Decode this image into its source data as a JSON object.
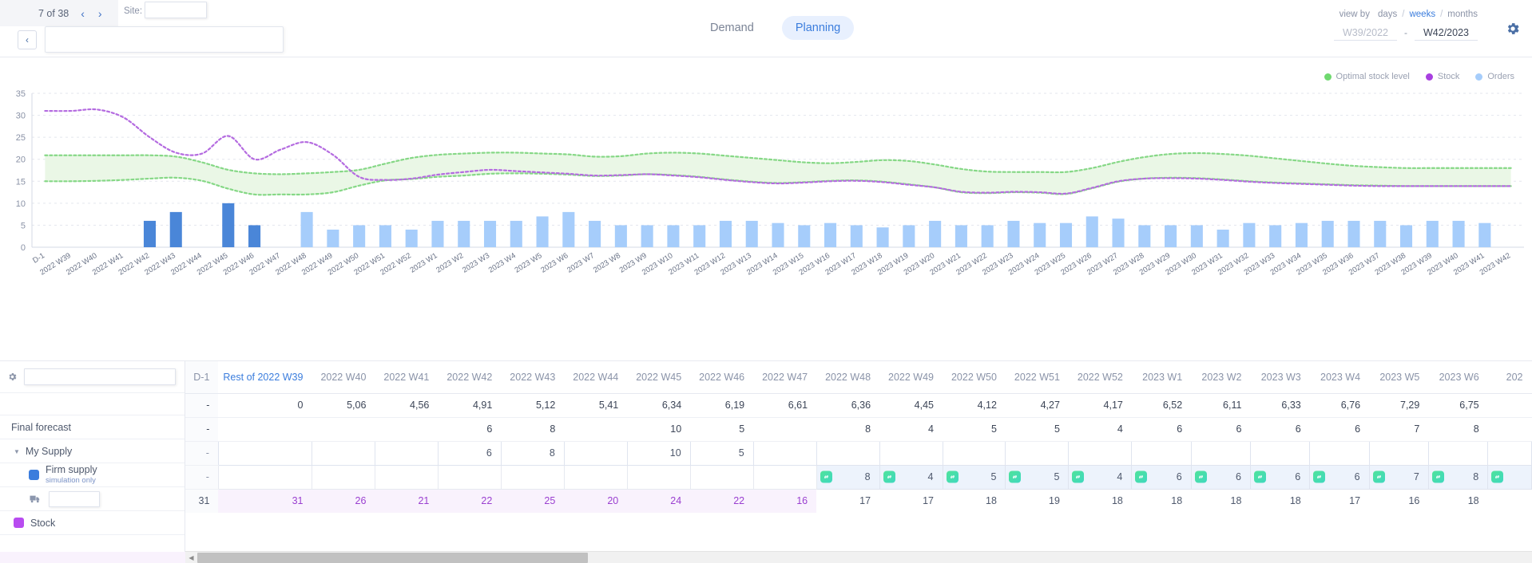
{
  "topbar": {
    "pager_text": "7 of 38",
    "prev_label": "‹",
    "next_label": "›",
    "site_label": "Site:",
    "site_value": "",
    "back_label": "‹",
    "name_value": "",
    "tabs": [
      {
        "label": "Demand",
        "active": false
      },
      {
        "label": "Planning",
        "active": true
      }
    ],
    "view_by_label": "view by",
    "view_options": [
      {
        "label": "days",
        "active": false
      },
      {
        "label": "weeks",
        "active": true
      },
      {
        "label": "months",
        "active": false
      }
    ],
    "separator": "/",
    "range_from": "W39/2022",
    "range_dash": "-",
    "range_to": "W42/2023",
    "gear_icon": "gear-icon"
  },
  "legend": [
    {
      "label": "Optimal stock level",
      "color": "#6fd96f"
    },
    {
      "label": "Stock",
      "color": "#a83fe0"
    },
    {
      "label": "Orders",
      "color": "#a6cdfb"
    }
  ],
  "chart_data": {
    "type": "bar",
    "title": "",
    "xlabel": "",
    "ylabel": "",
    "ylim": [
      0,
      35
    ],
    "yticks": [
      0,
      5,
      10,
      15,
      20,
      25,
      30,
      35
    ],
    "grid": true,
    "legend_position": "top-right",
    "categories": [
      "D-1",
      "2022 W39",
      "2022 W40",
      "2022 W41",
      "2022 W42",
      "2022 W43",
      "2022 W44",
      "2022 W45",
      "2022 W46",
      "2022 W47",
      "2022 W48",
      "2022 W49",
      "2022 W50",
      "2022 W51",
      "2022 W52",
      "2023 W1",
      "2023 W2",
      "2023 W3",
      "2023 W4",
      "2023 W5",
      "2023 W6",
      "2023 W7",
      "2023 W8",
      "2023 W9",
      "2023 W10",
      "2023 W11",
      "2023 W12",
      "2023 W13",
      "2023 W14",
      "2023 W15",
      "2023 W16",
      "2023 W17",
      "2023 W18",
      "2023 W19",
      "2023 W20",
      "2023 W21",
      "2023 W22",
      "2023 W23",
      "2023 W24",
      "2023 W25",
      "2023 W26",
      "2023 W27",
      "2023 W28",
      "2023 W29",
      "2023 W30",
      "2023 W31",
      "2023 W32",
      "2023 W33",
      "2023 W34",
      "2023 W35",
      "2023 W36",
      "2023 W37",
      "2023 W38",
      "2023 W39",
      "2023 W40",
      "2023 W41",
      "2023 W42"
    ],
    "series": [
      {
        "name": "Orders",
        "type": "bar",
        "color": "#a6cdfb",
        "values": [
          0,
          0,
          0,
          0,
          6,
          8,
          0,
          10,
          5,
          0,
          8,
          4,
          5,
          5,
          4,
          6,
          6,
          6,
          6,
          7,
          8,
          6,
          5,
          5,
          5,
          5,
          6,
          6,
          5.5,
          5,
          5.5,
          5,
          4.5,
          5,
          6,
          5,
          5,
          6,
          5.5,
          5.5,
          7,
          6.5,
          5,
          5,
          5,
          4,
          5.5,
          5,
          5.5,
          6,
          6,
          6,
          5,
          6,
          6,
          5.5,
          0
        ],
        "highlight_color": "#4a86d8",
        "highlight_indices": [
          4,
          5,
          7,
          8
        ]
      },
      {
        "name": "Stock",
        "type": "line",
        "style": "dotted",
        "color": "#b46be0",
        "values": [
          31,
          31,
          31.3,
          29.5,
          25,
          21.5,
          21.3,
          25.3,
          20,
          22.2,
          23.9,
          21,
          16,
          15.3,
          15.6,
          16.5,
          17.1,
          17.6,
          17.3,
          17,
          16.7,
          16.3,
          16.4,
          16.6,
          16.3,
          15.9,
          15.3,
          14.8,
          14.5,
          14.7,
          15,
          15.1,
          14.8,
          14.2,
          13.6,
          12.6,
          12.4,
          12.6,
          12.5,
          12.2,
          13.5,
          15,
          15.6,
          15.7,
          15.6,
          15.3,
          14.9,
          14.6,
          14.4,
          14.2,
          14,
          13.9,
          13.9,
          13.9,
          13.9,
          13.9,
          13.9
        ]
      },
      {
        "name": "Optimal stock level upper",
        "type": "band-upper",
        "style": "dotted",
        "color": "#86d886",
        "values": [
          20.9,
          20.9,
          20.9,
          20.9,
          20.9,
          20.6,
          19.3,
          17.6,
          16.8,
          16.6,
          16.8,
          17.1,
          17.6,
          19,
          20.3,
          21,
          21.3,
          21.5,
          21.5,
          21.3,
          21.1,
          20.6,
          20.7,
          21.3,
          21.5,
          21.3,
          20.8,
          20.3,
          19.8,
          19.3,
          19.1,
          19.4,
          19.8,
          19.6,
          18.8,
          17.8,
          17.2,
          17.1,
          17.1,
          17.1,
          18,
          19.4,
          20.5,
          21.2,
          21.4,
          21.2,
          20.8,
          20.2,
          19.6,
          19,
          18.5,
          18.2,
          18,
          18,
          18,
          18,
          18
        ]
      },
      {
        "name": "Optimal stock level lower",
        "type": "band-lower",
        "style": "dotted",
        "color": "#86d886",
        "values": [
          15,
          15,
          15.1,
          15.3,
          15.6,
          15.8,
          15.1,
          13.3,
          12,
          12,
          12,
          12.5,
          14,
          15.2,
          15.5,
          16,
          16.3,
          16.7,
          16.8,
          16.7,
          16.5,
          16.2,
          16.3,
          16.6,
          16.4,
          16,
          15.4,
          14.9,
          14.6,
          14.8,
          15.1,
          15.2,
          14.9,
          14.3,
          13.6,
          12.5,
          12.3,
          12.5,
          12.4,
          12.1,
          13.4,
          14.9,
          15.6,
          15.8,
          15.7,
          15.4,
          15,
          14.7,
          14.5,
          14.3,
          14.1,
          14,
          13.9,
          13.9,
          13.9,
          13.9,
          13.9
        ]
      }
    ]
  },
  "table": {
    "search_value": "",
    "gear_icon": "gear-icon",
    "row_labels": {
      "final_forecast": "Final forecast",
      "my_supply": "My Supply",
      "firm_supply_title": "Firm supply",
      "firm_supply_sub": "simulation only",
      "order_input_value": "",
      "stock": "Stock"
    },
    "colors": {
      "firm_supply_swatch": "#3b7ddd",
      "stock_swatch": "#b84cf0"
    },
    "columns": [
      "D-1",
      "Rest of 2022 W39",
      "2022 W40",
      "2022 W41",
      "2022 W42",
      "2022 W43",
      "2022 W44",
      "2022 W45",
      "2022 W46",
      "2022 W47",
      "2022 W48",
      "2022 W49",
      "2022 W50",
      "2022 W51",
      "2022 W52",
      "2023 W1",
      "2023 W2",
      "2023 W3",
      "2023 W4",
      "2023 W5",
      "2023 W6",
      "202"
    ],
    "rows": [
      {
        "name": "final-forecast",
        "values": [
          "-",
          "0",
          "5,06",
          "4,56",
          "4,91",
          "5,12",
          "5,41",
          "6,34",
          "6,19",
          "6,61",
          "6,36",
          "4,45",
          "4,12",
          "4,27",
          "4,17",
          "6,52",
          "6,11",
          "6,33",
          "6,76",
          "7,29",
          "6,75",
          ""
        ]
      },
      {
        "name": "my-supply",
        "values": [
          "-",
          "",
          "",
          "",
          "6",
          "8",
          "",
          "10",
          "5",
          "",
          "8",
          "4",
          "5",
          "5",
          "4",
          "6",
          "6",
          "6",
          "6",
          "7",
          "8",
          ""
        ]
      },
      {
        "name": "firm-supply",
        "values": [
          "-",
          "",
          "",
          "",
          "6",
          "8",
          "",
          "10",
          "5",
          "",
          "",
          "",
          "",
          "",
          "",
          "",
          "",
          "",
          "",
          "",
          "",
          ""
        ]
      },
      {
        "name": "orders",
        "values": [
          "-",
          "",
          "",
          "",
          "",
          "",
          "",
          "",
          "",
          "",
          "8",
          "4",
          "5",
          "5",
          "4",
          "6",
          "6",
          "6",
          "6",
          "7",
          "8",
          ""
        ],
        "badges": [
          false,
          false,
          false,
          false,
          false,
          false,
          false,
          false,
          false,
          false,
          true,
          true,
          true,
          true,
          true,
          true,
          true,
          true,
          true,
          true,
          true,
          true
        ]
      },
      {
        "name": "stock",
        "values": [
          "31",
          "31",
          "26",
          "21",
          "22",
          "25",
          "20",
          "24",
          "22",
          "16",
          "17",
          "17",
          "18",
          "19",
          "18",
          "18",
          "18",
          "18",
          "17",
          "16",
          "18",
          ""
        ]
      }
    ]
  },
  "scrollbar": {
    "left_arrow": "◀"
  }
}
